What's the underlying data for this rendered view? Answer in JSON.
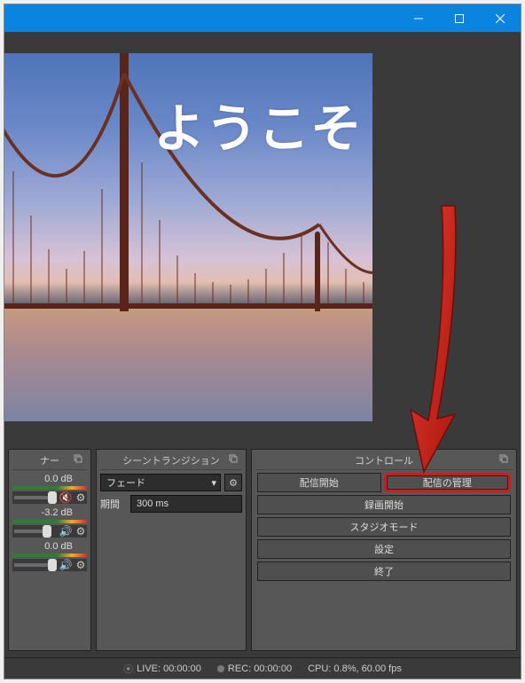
{
  "preview": {
    "overlay_text": "ようこそ"
  },
  "mixer": {
    "partial_title": "ナー",
    "tracks": [
      {
        "db": "0.0 dB",
        "muted": true
      },
      {
        "db": "-3.2 dB",
        "muted": false
      },
      {
        "db": "0.0 dB",
        "muted": false
      }
    ]
  },
  "transitions": {
    "title": "シーントランジション",
    "selected": "フェード",
    "duration_label": "期間",
    "duration_value": "300 ms"
  },
  "controls": {
    "title": "コントロール",
    "start_stream": "配信開始",
    "manage_stream": "配信の管理",
    "start_record": "録画開始",
    "studio_mode": "スタジオモード",
    "settings": "設定",
    "exit": "終了"
  },
  "status": {
    "live": "LIVE: 00:00:00",
    "rec": "REC: 00:00:00",
    "cpu": "CPU: 0.8%, 60.00 fps"
  }
}
